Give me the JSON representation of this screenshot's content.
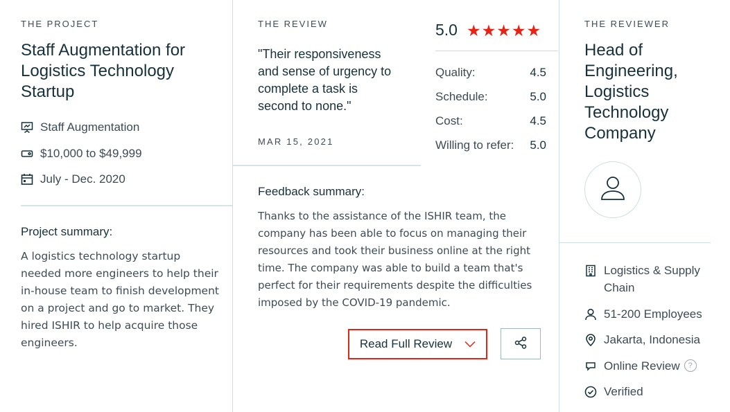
{
  "project": {
    "eyebrow": "THE PROJECT",
    "title_lines": [
      "Staff Augmentation for",
      "Logistics Technology",
      "Startup"
    ],
    "service": "Staff Augmentation",
    "budget": "$10,000 to $49,999",
    "dates": "July - Dec. 2020",
    "summary_label": "Project summary:",
    "summary_lines": [
      "A logistics technology startup",
      "needed more engineers to help their",
      "in-house team to finish development",
      "on a project and go to market. They",
      "hired ISHIR to help acquire those",
      "engineers."
    ],
    "icons": {
      "service": "presentation-board-icon",
      "budget": "price-tag-icon",
      "dates": "calendar-icon"
    }
  },
  "review": {
    "eyebrow": "THE REVIEW",
    "quote_lines": [
      "\"Their responsiveness",
      "and sense of urgency to",
      "complete a task is",
      "second to none.\""
    ],
    "date": "MAR 15, 2021",
    "rating": "5.0",
    "stars": 5,
    "scores": [
      {
        "label": "Quality:",
        "value": "4.5"
      },
      {
        "label": "Schedule:",
        "value": "5.0"
      },
      {
        "label": "Cost:",
        "value": "4.5"
      },
      {
        "label": "Willing to refer:",
        "value": "5.0"
      }
    ],
    "feedback_label": "Feedback summary:",
    "feedback_lines": [
      "Thanks to the assistance of the ISHIR team, the",
      "company has been able to focus on managing their",
      "resources and took their business online at the right",
      "time. The company was able to build a team that's",
      "perfect for their requirements despite the difficulties",
      "imposed by the COVID-19 pandemic."
    ],
    "read_button": "Read Full Review",
    "share_icon": "share-icon"
  },
  "reviewer": {
    "eyebrow": "THE REVIEWER",
    "title_lines": [
      "Head of",
      "Engineering,",
      "Logistics",
      "Technology",
      "Company"
    ],
    "industry_lines": [
      "Logistics & Supply",
      "Chain"
    ],
    "employees": "51-200 Employees",
    "location": "Jakarta, Indonesia",
    "review_type": "Online Review",
    "help": "?",
    "verified": "Verified"
  },
  "colors": {
    "accent": "#e62415",
    "text": "#17313b",
    "muted": "#3e4b54",
    "divider": "#d6e4e7"
  }
}
